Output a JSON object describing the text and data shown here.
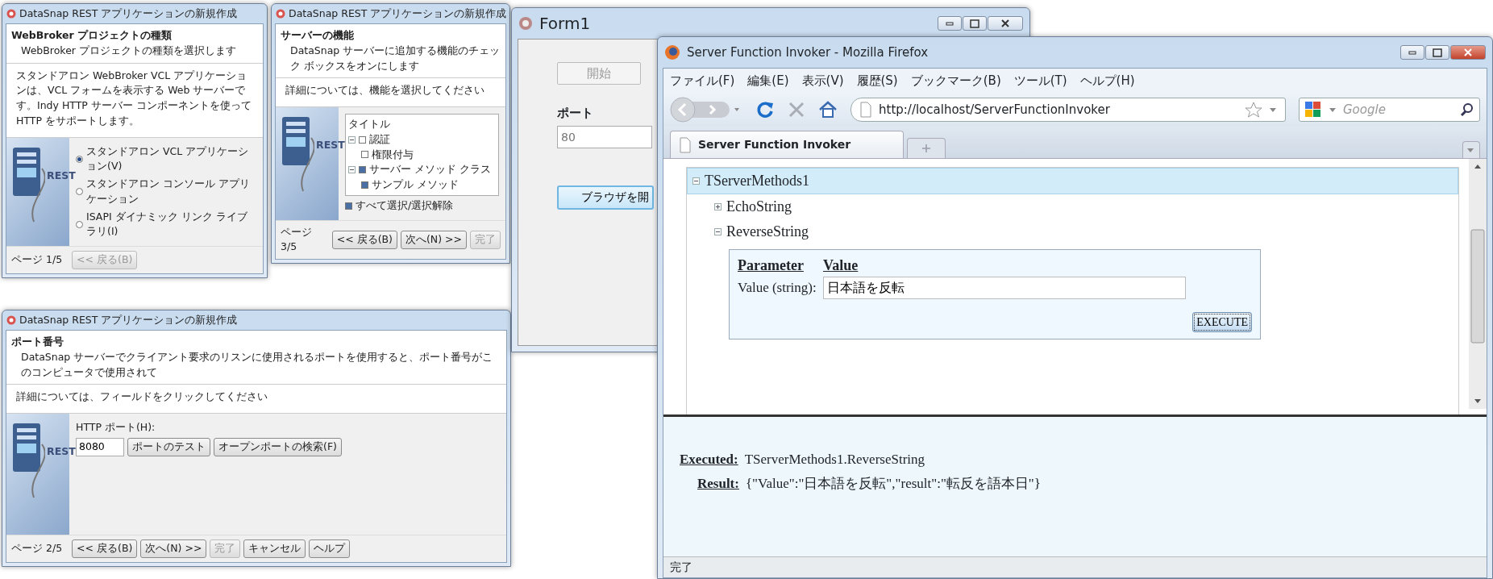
{
  "wizards": [
    {
      "title": "DataSnap REST アプリケーションの新規作成",
      "heading": "WebBroker プロジェクトの種類",
      "subheading": "WebBroker プロジェクトの種類を選択します",
      "description": "スタンドアロン WebBroker VCL アプリケーションは、VCL フォームを表示する Web サーバーです。Indy HTTP サーバー コンポーネントを使って HTTP をサポートします。",
      "image_label": "REST",
      "body": {
        "kind": "radio_list",
        "options": [
          {
            "label": "スタンドアロン VCL アプリケーション(V)",
            "checked": true
          },
          {
            "label": "スタンドアロン コンソール アプリケーション",
            "checked": false
          },
          {
            "label": "ISAPI ダイナミック リンク ライブラリ(I)",
            "checked": false
          }
        ]
      },
      "page": "ページ 1/5",
      "buttons": [
        {
          "label": "<< 戻る(B)",
          "disabled": true
        }
      ]
    },
    {
      "title": "DataSnap REST アプリケーションの新規作成",
      "heading": "サーバーの機能",
      "subheading": "DataSnap サーバーに追加する機能のチェック ボックスをオンにします",
      "description": "詳細については、機能を選択してください",
      "image_label": "REST",
      "body": {
        "kind": "feature_tree",
        "header": "タイトル",
        "items": [
          {
            "label": "認証",
            "checked": false,
            "expanded": true,
            "children": [
              {
                "label": "権限付与",
                "checked": false
              }
            ]
          },
          {
            "label": "サーバー メソッド クラス",
            "checked": true,
            "expanded": true,
            "children": [
              {
                "label": "サンプル メソッド",
                "checked": true
              }
            ]
          }
        ],
        "select_all": {
          "label": "すべて選択/選択解除",
          "checked": true
        }
      },
      "page": "ページ 3/5",
      "buttons": [
        {
          "label": "<< 戻る(B)",
          "disabled": false
        },
        {
          "label": "次へ(N) >>",
          "disabled": false
        },
        {
          "label": "完了",
          "disabled": true
        }
      ]
    },
    {
      "title": "DataSnap REST アプリケーションの新規作成",
      "heading": "ポート番号",
      "subheading": "DataSnap サーバーでクライアント要求のリスンに使用されるポートを使用すると、ポート番号がこのコンピュータで使用されて",
      "description": "詳細については、フィールドをクリックしてください",
      "image_label": "REST",
      "body": {
        "kind": "port",
        "label": "HTTP ポート(H):",
        "value": "8080",
        "buttons": [
          "ポートのテスト",
          "オープンポートの検索(F)"
        ]
      },
      "page": "ページ 2/5",
      "buttons": [
        {
          "label": "<< 戻る(B)",
          "disabled": false
        },
        {
          "label": "次へ(N) >>",
          "disabled": false
        },
        {
          "label": "完了",
          "disabled": true
        },
        {
          "label": "キャンセル",
          "disabled": false
        },
        {
          "label": "ヘルプ",
          "disabled": false
        }
      ]
    }
  ],
  "form1": {
    "title": "Form1",
    "start_button": {
      "label": "開始",
      "disabled": true
    },
    "port_label": "ポート",
    "port_value": "80",
    "open_button": "ブラウザを開"
  },
  "firefox": {
    "title": "Server Function Invoker - Mozilla Firefox",
    "menu": [
      "ファイル(F)",
      "編集(E)",
      "表示(V)",
      "履歴(S)",
      "ブックマーク(B)",
      "ツール(T)",
      "ヘルプ(H)"
    ],
    "url": "http://localhost/ServerFunctionInvoker",
    "search_placeholder": "Google",
    "tabs": [
      {
        "label": "Server Function Invoker",
        "selected": true
      }
    ],
    "tree": {
      "label": "TServerMethods1",
      "expanded": true,
      "selected": true,
      "children": [
        {
          "label": "EchoString",
          "expanded": false
        },
        {
          "label": "ReverseString",
          "expanded": true,
          "params": {
            "columns": [
              "Parameter",
              "Value"
            ],
            "rows": [
              {
                "name": "Value (string):",
                "value": "日本語を反転"
              }
            ],
            "button": "EXECUTE"
          }
        }
      ]
    },
    "results": {
      "executed_label": "Executed:",
      "executed_value": "TServerMethods1.ReverseString",
      "result_label": "Result:",
      "result_value": "{\"Value\":\"日本語を反転\",\"result\":\"転反を語本日\"}"
    },
    "status": "完了"
  }
}
